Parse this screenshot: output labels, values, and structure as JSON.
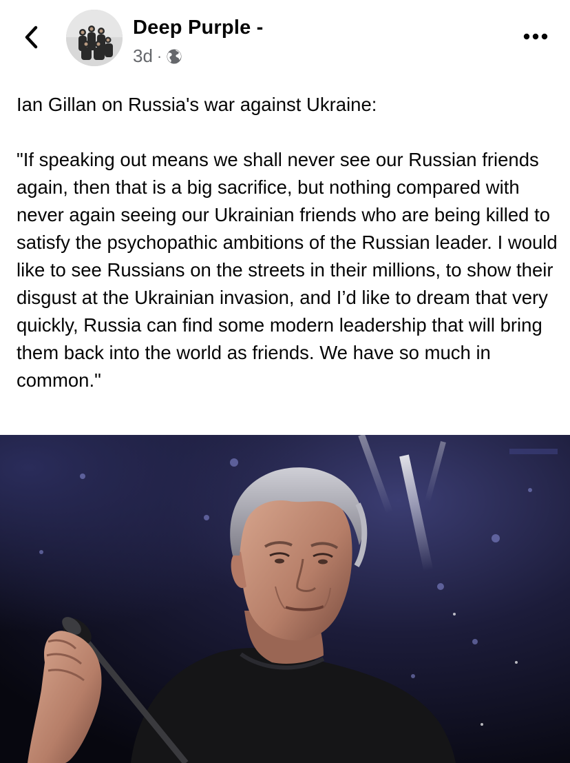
{
  "header": {
    "back_icon": "chevron-left-icon",
    "page_name": "Deep Purple -",
    "timestamp": "3d",
    "separator": "·",
    "audience_icon": "globe-icon",
    "more_icon": "more-horizontal-icon"
  },
  "post": {
    "intro": "Ian Gillan on Russia's war against Ukraine:",
    "quote": "\"If speaking out means we shall never see our Russian friends again, then that is a big sacrifice, but nothing compared with never again seeing our Ukrainian friends who are being killed to satisfy the psychopathic ambitions of the Russian leader. I would like to see Russians on the streets in their millions, to show their disgust at the Ukrainian invasion, and I’d like to dream that very quickly, Russia can find some modern leadership that will bring them back into the world as friends. We have so much in common.\""
  },
  "colors": {
    "text": "#050505",
    "secondary_text": "#65676b",
    "photo_background": "#0c0c18"
  }
}
